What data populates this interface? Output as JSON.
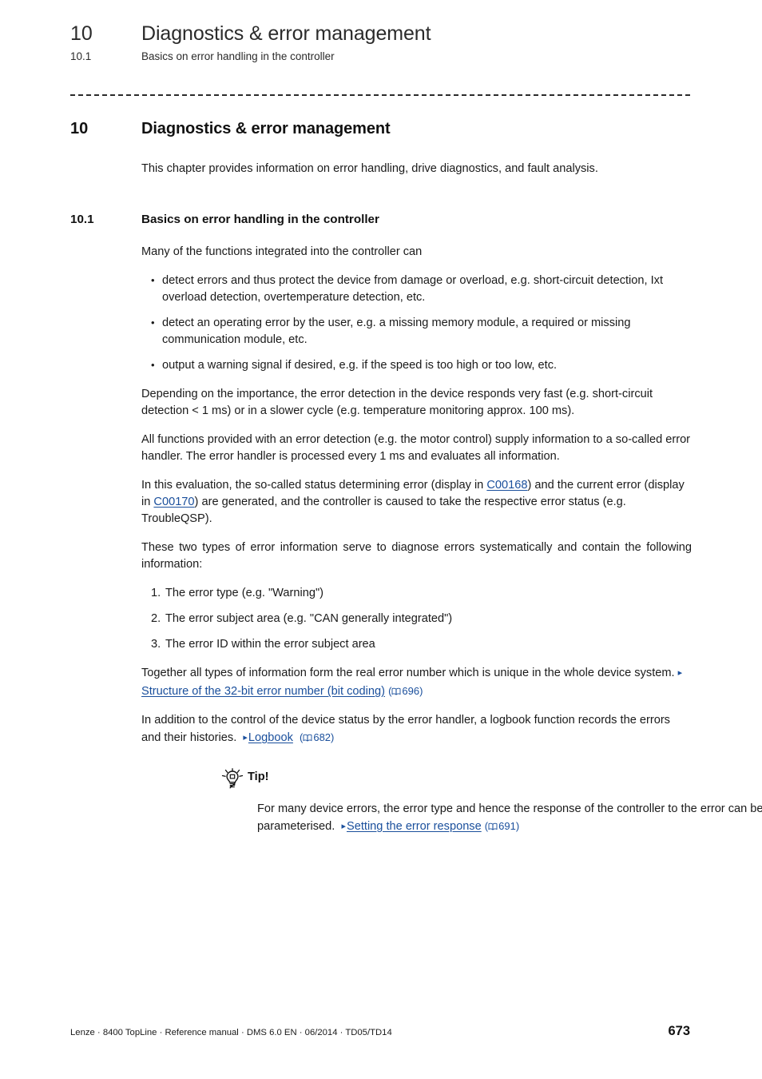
{
  "running_header": {
    "chapter_number": "10",
    "chapter_title": "Diagnostics & error management",
    "section_number": "10.1",
    "section_title": "Basics on error handling in the controller"
  },
  "heading1": {
    "number": "10",
    "text": "Diagnostics & error management"
  },
  "intro": "This chapter provides information on error handling, drive diagnostics, and fault analysis.",
  "heading2": {
    "number": "10.1",
    "text": "Basics on error handling in the controller"
  },
  "body": {
    "lead_in": "Many of the functions integrated into the controller can",
    "bullets": [
      "detect errors and thus protect the device from damage or overload, e.g. short-circuit detection, Ixt overload detection, overtemperature detection, etc.",
      "detect an operating error by the user, e.g. a missing memory module, a required or missing communication module, etc.",
      "output a warning signal if desired, e.g. if the speed is too high or too low, etc."
    ],
    "para_importance": "Depending on the importance, the error detection in the device responds very fast (e.g. short-circuit detection < 1 ms) or in a slower cycle (e.g. temperature monitoring approx. 100 ms).",
    "para_handler": "All functions provided with an error detection (e.g. the motor control) supply information to a so-called error handler. The error handler is processed every 1 ms and evaluates all information.",
    "para_evaluation": {
      "part1": "In this evaluation, the so-called status determining error (display in ",
      "code1": "C00168",
      "part2": ") and the current error (display in ",
      "code2": "C00170",
      "part3": ") are generated, and the controller is caused to take the respective error status (e.g. TroubleQSP)."
    },
    "para_two_types": "These two types of error information serve to diagnose errors systematically and contain the following information:",
    "numbered": [
      "The error type (e.g. \"Warning\")",
      "The error subject area (e.g. \"CAN generally integrated\")",
      "The error ID within the error subject area"
    ],
    "para_together": {
      "text": "Together all types of information form the real error number which is unique in the whole device system.",
      "link_label": "Structure of the 32-bit error number (bit coding)",
      "page_ref": "696"
    },
    "para_logbook": {
      "text": "In addition to the control of the device status by the error handler, a logbook function records the errors and their histories.",
      "link_label": "Logbook",
      "page_ref": "682"
    }
  },
  "tip": {
    "icon": "lightbulb-icon",
    "title": "Tip!",
    "text": "For many device errors, the error type and hence the response of the controller to the error can be parameterised.",
    "link_label": "Setting the error response",
    "page_ref": "691"
  },
  "footer": {
    "left": "Lenze · 8400 TopLine · Reference manual · DMS 6.0 EN · 06/2014 · TD05/TD14",
    "page_number": "673"
  },
  "colors": {
    "link": "#1a4f9c",
    "text": "#1a1a1a",
    "rule": "#2b2b2b"
  }
}
